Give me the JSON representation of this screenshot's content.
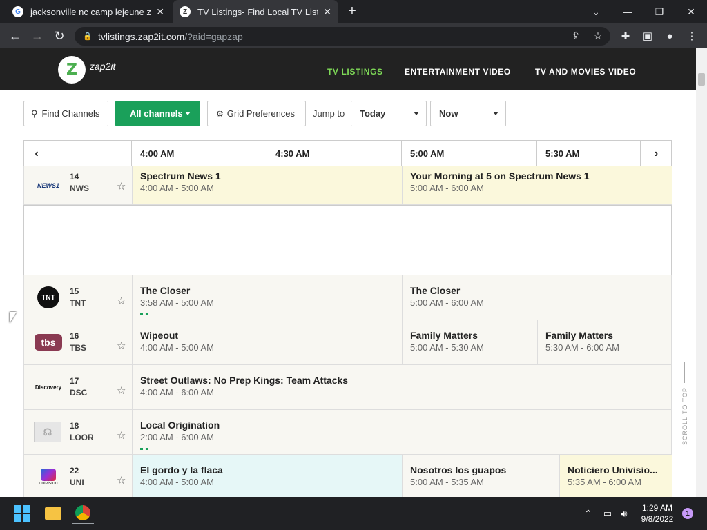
{
  "browser": {
    "tabs": [
      {
        "title": "jacksonville nc camp lejeune zip c",
        "favicon": "G"
      },
      {
        "title": "TV Listings- Find Local TV Listing",
        "favicon": "Z"
      }
    ],
    "url_host": "tvlistings.zap2it.com",
    "url_path": "/?aid=gapzap"
  },
  "site": {
    "logo_letter": "Z",
    "logo_text": "zap2it",
    "nav": [
      "TV LISTINGS",
      "ENTERTAINMENT VIDEO",
      "TV AND MOVIES VIDEO"
    ]
  },
  "controls": {
    "find_channels": "Find Channels",
    "all_channels": "All channels",
    "grid_preferences": "Grid Preferences",
    "jump_to": "Jump to",
    "day": "Today",
    "time": "Now"
  },
  "grid": {
    "times": [
      "4:00 AM",
      "4:30 AM",
      "5:00 AM",
      "5:30 AM"
    ],
    "rows": [
      {
        "logo": "NEWS1",
        "number": "14",
        "sign": "NWS",
        "programs": [
          {
            "title": "Spectrum News 1",
            "time": "4:00 AM - 5:00 AM"
          },
          {
            "title": "Your Morning at 5 on Spectrum News 1",
            "time": "5:00 AM - 6:00 AM"
          }
        ]
      },
      {
        "logo": "TNT",
        "number": "15",
        "sign": "TNT",
        "programs": [
          {
            "title": "The Closer",
            "time": "3:58 AM - 5:00 AM"
          },
          {
            "title": "The Closer",
            "time": "5:00 AM - 6:00 AM"
          }
        ]
      },
      {
        "logo": "tbs",
        "number": "16",
        "sign": "TBS",
        "programs": [
          {
            "title": "Wipeout",
            "time": "4:00 AM - 5:00 AM"
          },
          {
            "title": "Family Matters",
            "time": "5:00 AM - 5:30 AM"
          },
          {
            "title": "Family Matters",
            "time": "5:30 AM - 6:00 AM"
          }
        ]
      },
      {
        "logo": "Discovery",
        "number": "17",
        "sign": "DSC",
        "programs": [
          {
            "title": "Street Outlaws: No Prep Kings: Team Attacks",
            "time": "4:00 AM - 6:00 AM"
          }
        ]
      },
      {
        "logo": "",
        "number": "18",
        "sign": "LOOR",
        "programs": [
          {
            "title": "Local Origination",
            "time": "2:00 AM - 6:00 AM"
          }
        ]
      },
      {
        "logo": "univision",
        "number": "22",
        "sign": "UNI",
        "programs": [
          {
            "title": "El gordo y la flaca",
            "time": "4:00 AM - 5:00 AM"
          },
          {
            "title": "Nosotros los guapos",
            "time": "5:00 AM - 5:35 AM"
          },
          {
            "title": "Noticiero Univisio...",
            "time": "5:35 AM - 6:00 AM"
          }
        ]
      }
    ]
  },
  "scroll_to_top": "SCROLL TO TOP",
  "taskbar": {
    "time": "1:29 AM",
    "date": "9/8/2022",
    "notifications": "1"
  },
  "colors": {
    "accent_green": "#1aa05a",
    "nav_active": "#7ed957",
    "highlight_yellow": "#fbf8dc",
    "highlight_cyan": "#e6f7f7"
  }
}
